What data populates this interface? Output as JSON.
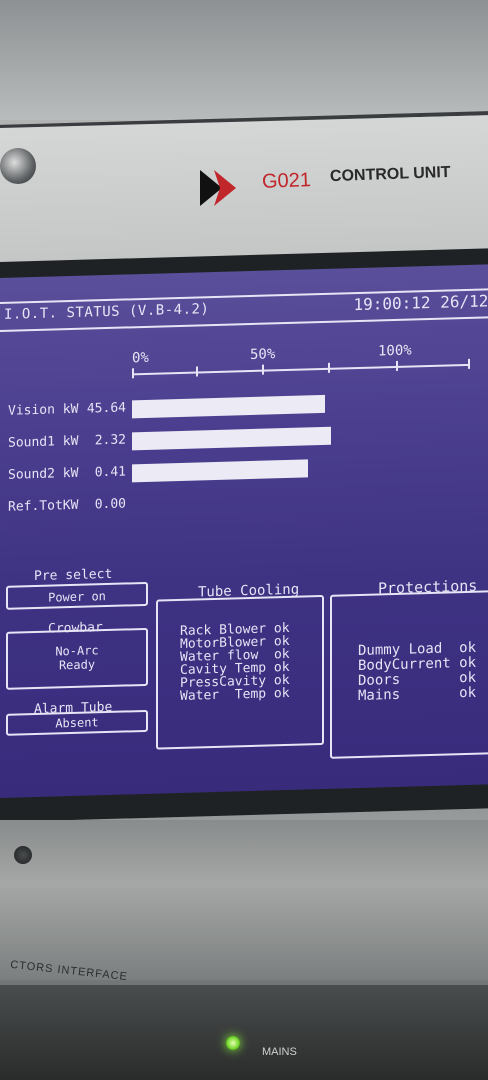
{
  "device": {
    "brand": "G021",
    "unit_name": "CONTROL UNIT",
    "interface_label": "CTORS INTERFACE",
    "mains_label": "MAINS"
  },
  "screen": {
    "title": "I.O.T. STATUS (V.B-4.2)",
    "clock": "19:00:12 26/12/",
    "scale": [
      "0%",
      "50%",
      "100%"
    ],
    "meters": [
      {
        "label": "Vision kW",
        "value": "45.64",
        "fill": 0.57
      },
      {
        "label": "Sound1 kW",
        "value": "2.32",
        "fill": 0.59
      },
      {
        "label": "Sound2 kW",
        "value": "0.41",
        "fill": 0.52
      },
      {
        "label": "Ref.TotKW",
        "value": "0.00",
        "fill": 0
      }
    ],
    "preselect": {
      "title": "Pre select",
      "value": "Power on"
    },
    "crowbar": {
      "title": "Crowbar",
      "line1": "No-Arc",
      "line2": "Ready"
    },
    "alarm": {
      "title": "Alarm Tube",
      "value": "Absent"
    },
    "tube_cooling": {
      "title": "Tube Cooling",
      "items": [
        {
          "label": "Rack Blower",
          "status": "ok"
        },
        {
          "label": "MotorBlower",
          "status": "ok"
        },
        {
          "label": "Water flow",
          "status": "ok"
        },
        {
          "label": "Cavity Temp",
          "status": "ok"
        },
        {
          "label": "PressCavity",
          "status": "ok"
        },
        {
          "label": "Water  Temp",
          "status": "ok"
        }
      ]
    },
    "protections": {
      "title": "Protections",
      "items": [
        {
          "label": "Dummy Load",
          "status": "ok"
        },
        {
          "label": "BodyCurrent",
          "status": "ok"
        },
        {
          "label": "Doors",
          "status": "ok"
        },
        {
          "label": "Mains",
          "status": "ok"
        }
      ]
    }
  },
  "colors": {
    "screen_bg": "#4c3f90",
    "screen_fg": "#e7e4f6",
    "brand_red": "#c0262a",
    "led_green": "#71d62a"
  }
}
